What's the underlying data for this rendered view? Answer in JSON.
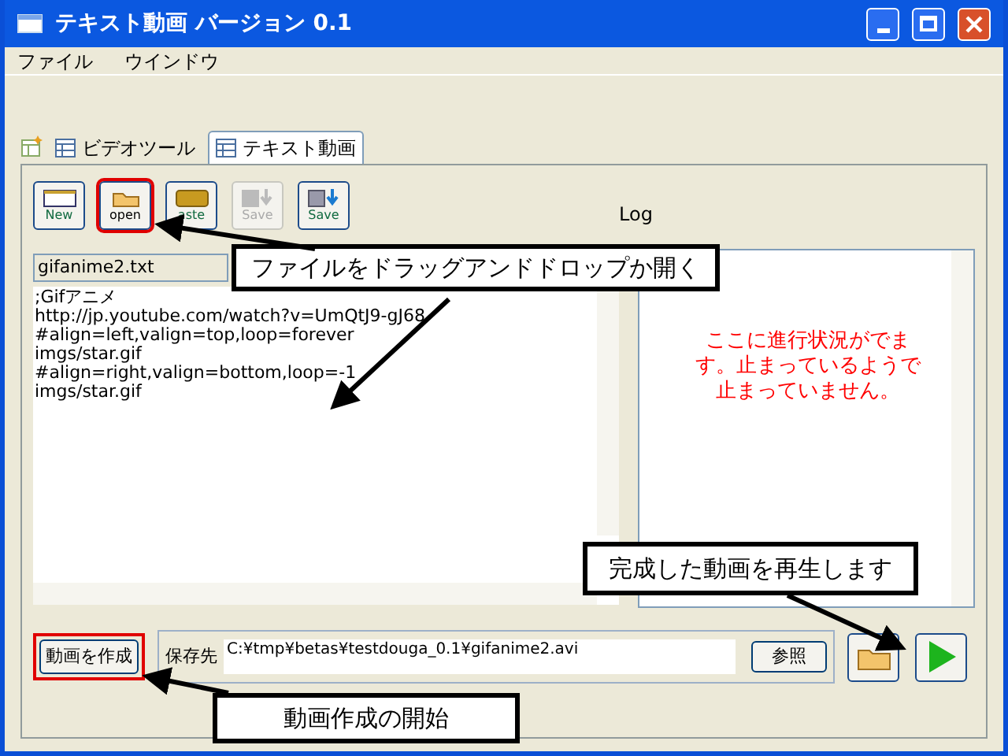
{
  "window": {
    "title": "テキスト動画 バージョン 0.1"
  },
  "menu": [
    "ファイル",
    "ウインドウ"
  ],
  "tabs": [
    {
      "label": "ビデオツール",
      "selected": false
    },
    {
      "label": "テキスト動画",
      "selected": true
    }
  ],
  "toolbar": [
    {
      "kind": "new",
      "label": "New",
      "disabled": false,
      "highlighted": false
    },
    {
      "kind": "open",
      "label": "open",
      "disabled": false,
      "highlighted": true
    },
    {
      "kind": "paste",
      "label": "aste",
      "disabled": false,
      "highlighted": false
    },
    {
      "kind": "save",
      "label": "Save",
      "disabled": true,
      "highlighted": false
    },
    {
      "kind": "saveas",
      "label": "Save",
      "disabled": false,
      "highlighted": false
    }
  ],
  "editor": {
    "filename": "gifanime2.txt",
    "lines": [
      ";Gifアニメ",
      "http://jp.youtube.com/watch?v=UmQtJ9-gJ68",
      "#align=left,valign=top,loop=forever",
      "imgs/star.gif",
      "#align=right,valign=bottom,loop=-1",
      "imgs/star.gif"
    ]
  },
  "log": {
    "title": "Log",
    "message": "ここに進行状況がでます。止まっているようで止まっていません。"
  },
  "output": {
    "create_button": "動画を作成",
    "highlighted": true,
    "label": "保存先",
    "path": "C:¥tmp¥betas¥testdouga_0.1¥gifanime2.avi",
    "browse_button": "参照"
  },
  "callouts": [
    "ファイルをドラッグアンドドロップか開く",
    "完成した動画を再生します",
    "動画作成の開始"
  ]
}
